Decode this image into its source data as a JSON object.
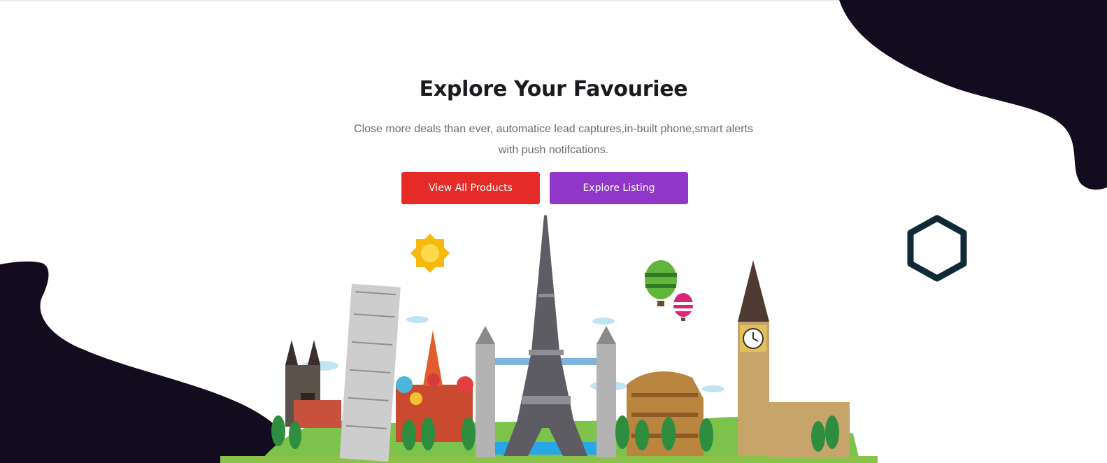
{
  "hero": {
    "title": "Explore Your Favouriee",
    "subtitle": "Close more deals than ever, automatice lead captures,in-built phone,smart alerts with push notifcations.",
    "buttons": {
      "view_all_products": "View All Products",
      "explore_listing": "Explore Listing"
    }
  },
  "colors": {
    "primary_red": "#e52b28",
    "primary_purple": "#9036c8",
    "dark_blob": "#120c1e",
    "hexagon": "#0e2a36"
  },
  "icons": [
    "hexagon-icon",
    "sun-icon",
    "balloon-icon"
  ]
}
